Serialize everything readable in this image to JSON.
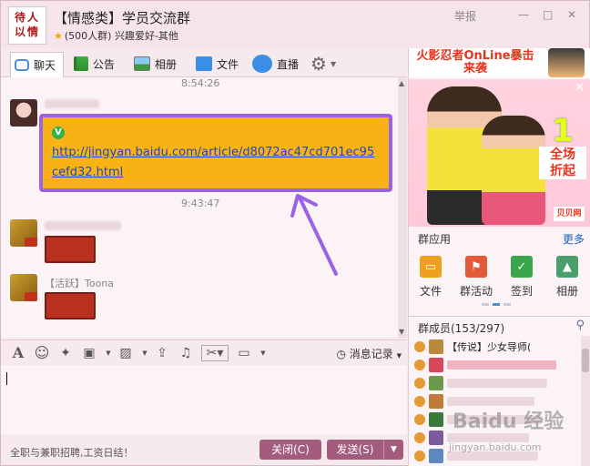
{
  "window": {
    "logo_text": "待人\n以情",
    "group_name": "【情感类】学员交流群",
    "group_meta": "(500人群) 兴趣爱好-其他",
    "report_label": "举报",
    "min_label": "—",
    "max_label": "□",
    "close_label": "✕"
  },
  "tabs": [
    {
      "label": "聊天",
      "icon": "chat-bubble-icon"
    },
    {
      "label": "公告",
      "icon": "flag-icon"
    },
    {
      "label": "相册",
      "icon": "picture-icon"
    },
    {
      "label": "文件",
      "icon": "folder-icon"
    },
    {
      "label": "直播",
      "icon": "live-bear-icon"
    },
    {
      "label": "",
      "icon": "gear-icon"
    }
  ],
  "chat": {
    "timestamp_1": "8:54:26",
    "timestamp_2": "9:43:47",
    "link_url": "http://jingyan.baidu.com/article/d8072ac47cd701ec95cefd32.html",
    "sender_label": "【活跃】Toona"
  },
  "input_toolbar": {
    "history_label": "消息记录",
    "icons": [
      "font-icon",
      "emoji-icon",
      "magic-icon",
      "gift-icon",
      "image-icon",
      "upload-icon",
      "music-icon",
      "scissors-icon",
      "screen-icon"
    ]
  },
  "bottom": {
    "promo_text": "全职与兼职招聘,工资日结！",
    "close_button": "关闭(C)",
    "send_button": "发送(S)"
  },
  "ads": {
    "top_text": "火影忍者OnLine暴击来袭",
    "sale_big": "1",
    "sale_line1": "全场",
    "sale_line2": "折起",
    "logo_text": "贝贝网",
    "close_label": "✕"
  },
  "apps": {
    "title": "群应用",
    "more": "更多",
    "items": [
      {
        "label": "文件",
        "color": "#f0a020"
      },
      {
        "label": "群活动",
        "color": "#e25a3a"
      },
      {
        "label": "签到",
        "color": "#3aa64a"
      },
      {
        "label": "相册",
        "color": "#4aa06a"
      }
    ]
  },
  "members": {
    "title": "群成员(153/297)",
    "first_member": "【传说】少女导师(",
    "watermark": "Baidu 经验",
    "watermark_sub": "jingyan.baidu.com"
  }
}
